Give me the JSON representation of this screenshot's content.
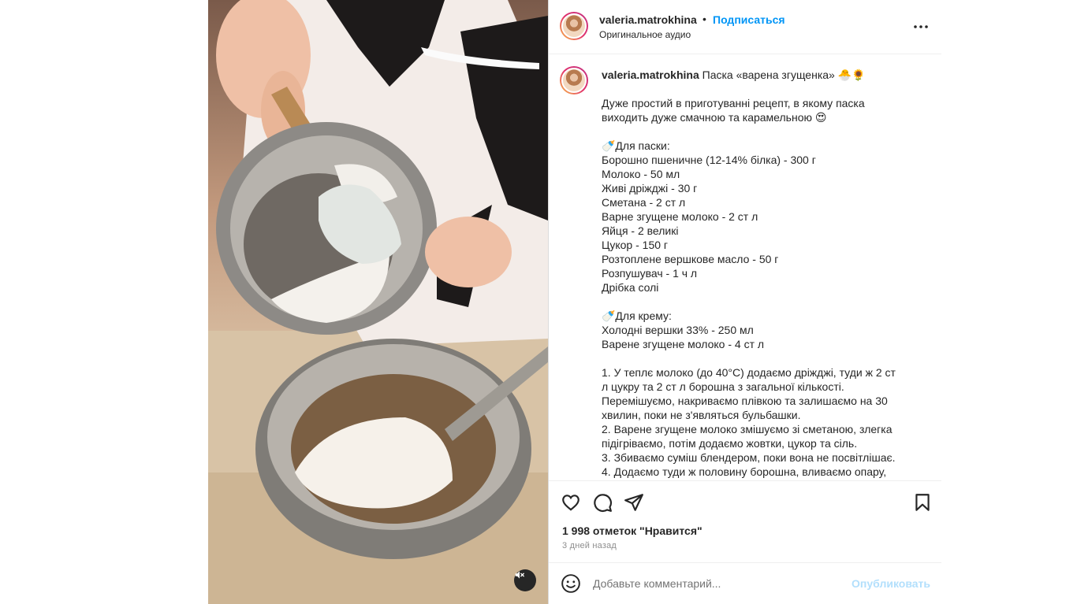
{
  "post": {
    "username": "valeria.matrokhina",
    "separator": "•",
    "follow_label": "Подписаться",
    "audio_label": "Оригинальное аудио",
    "more_icon": "more-horizontal-icon"
  },
  "caption": {
    "username": "valeria.matrokhina",
    "title": "Паска «варена згущенка» 🐣🌻",
    "lines": [
      "Дуже простий в приготуванні рецепт, в якому паска",
      "виходить дуже смачною та карамельною 😍",
      "",
      "🍼Для паски:",
      "Борошно пшеничне (12-14% білка) - 300 г",
      "Молоко - 50 мл",
      "Живі дріжджі - 30 г",
      "Сметана - 2 ст л",
      "Варне згущене молоко - 2 ст л",
      "Яйця - 2 великі",
      "Цукор - 150 г",
      "Розтоплене вершкове масло - 50 г",
      "Розпушувач - 1 ч л",
      "Дрібка солі",
      "",
      "🍼Для крему:",
      "Холодні вершки 33% - 250 мл",
      "Варене згущене молоко - 4 ст л",
      "",
      "1. У теплє молоко (до 40°С) додаємо дріжджі, туди ж 2 ст",
      "л цукру та 2 ст л борошна з загальної кількості.",
      "Перемішуємо, накриваємо плівкою та залишаємо на 30",
      "хвилин, поки не з'являться бульбашки.",
      "2. Варене згущене молоко змішуємо зі сметаною, злегка",
      "підігріваємо, потім додаємо жовтки, цукор та сіль.",
      "3. Збиваємо суміш блендером, поки вона не посвітлішає.",
      "4. Додаємо туди ж половину борошна, вливаємо опару,"
    ]
  },
  "actions": {
    "icons": [
      "heart-icon",
      "comment-icon",
      "share-icon",
      "bookmark-icon"
    ],
    "likes_text": "1 998 отметок \"Нравится\"",
    "date_text": "3 дней назад"
  },
  "comment": {
    "placeholder": "Добавьте комментарий...",
    "publish_label": "Опубликовать",
    "emoji_icon": "emoji-icon"
  },
  "media": {
    "mute_icon": "speaker-muted-icon"
  }
}
